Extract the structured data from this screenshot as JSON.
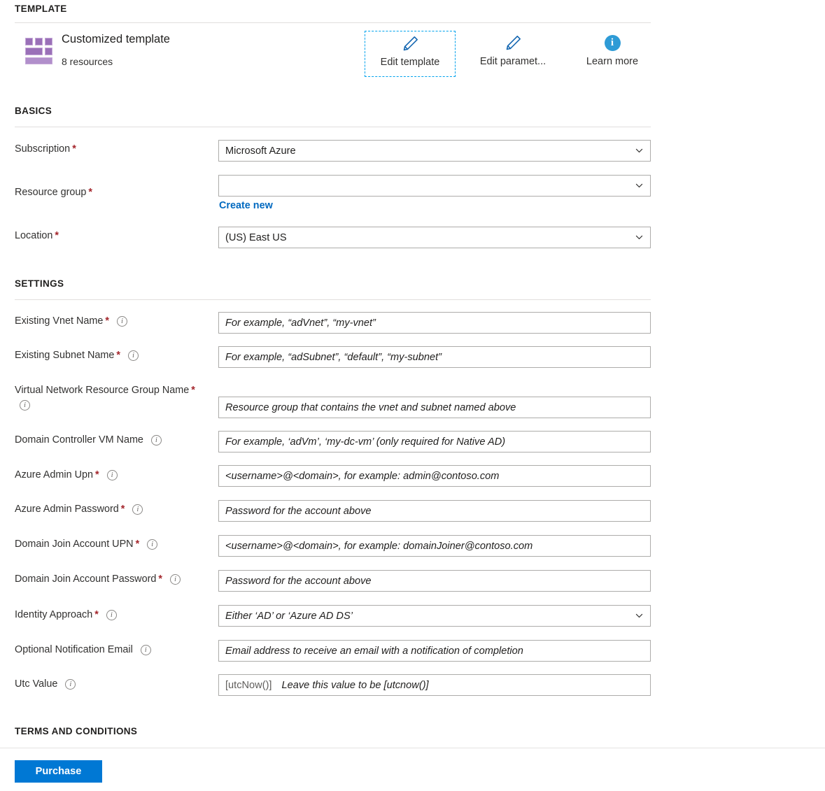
{
  "sections": {
    "template": "TEMPLATE",
    "basics": "BASICS",
    "settings": "SETTINGS",
    "terms": "TERMS AND CONDITIONS"
  },
  "template_card": {
    "icon": "template-grid-icon",
    "title": "Customized template",
    "subtitle": "8 resources",
    "actions": [
      {
        "label": "Edit template",
        "icon": "pencil-icon",
        "focused": true
      },
      {
        "label": "Edit paramet...",
        "icon": "pencil-icon",
        "focused": false
      },
      {
        "label": "Learn more",
        "icon": "info-circle-icon",
        "focused": false
      }
    ]
  },
  "basics": {
    "subscription": {
      "label": "Subscription",
      "required": true,
      "value": "Microsoft Azure",
      "placeholder": "",
      "control": "dropdown"
    },
    "resource_group": {
      "label": "Resource group",
      "required": true,
      "value": "",
      "placeholder": "",
      "control": "dropdown",
      "create_new_link": "Create new"
    },
    "location": {
      "label": "Location",
      "required": true,
      "value": "(US) East US",
      "placeholder": "",
      "control": "dropdown"
    }
  },
  "settings": [
    {
      "label": "Existing Vnet Name",
      "required": true,
      "info": true,
      "placeholder": "For example, “adVnet”, “my-vnet”",
      "control": "text"
    },
    {
      "label": "Existing Subnet Name",
      "required": true,
      "info": true,
      "placeholder": "For example, “adSubnet”, “default”, “my-subnet”",
      "control": "text"
    },
    {
      "label": "Virtual Network Resource Group Name",
      "required": true,
      "info": true,
      "placeholder": "Resource group that contains the vnet and subnet named above",
      "control": "text"
    },
    {
      "label": "Domain Controller VM Name",
      "required": false,
      "info": true,
      "placeholder": "For example, ‘adVm’, ‘my-dc-vm’ (only required for Native AD)",
      "control": "text"
    },
    {
      "label": "Azure Admin Upn",
      "required": true,
      "info": true,
      "placeholder": "<username>@<domain>, for example: admin@contoso.com",
      "control": "text"
    },
    {
      "label": "Azure Admin Password",
      "required": true,
      "info": true,
      "placeholder": "Password for the account above",
      "control": "password"
    },
    {
      "label": "Domain Join Account UPN",
      "required": true,
      "info": true,
      "placeholder": "<username>@<domain>, for example: domainJoiner@contoso.com",
      "control": "text"
    },
    {
      "label": "Domain Join Account Password",
      "required": true,
      "info": true,
      "placeholder": "Password for the account above",
      "control": "password"
    },
    {
      "label": "Identity Approach",
      "required": true,
      "info": true,
      "placeholder": "Either ‘AD’ or ‘Azure AD DS’",
      "control": "dropdown"
    },
    {
      "label": "Optional Notification Email",
      "required": false,
      "info": true,
      "placeholder": "Email address to receive an email with a notification of completion",
      "control": "text"
    },
    {
      "label": "Utc Value",
      "required": false,
      "info": true,
      "value": "[utcNow()]",
      "placeholder": "Leave this value to be [utcnow()]",
      "control": "text"
    }
  ],
  "footer": {
    "purchase_label": "Purchase"
  },
  "colors": {
    "accent": "#0078d4",
    "required_asterisk": "#a4262c",
    "link": "#0069c0",
    "focus_outline": "#00a2ed",
    "template_icon": "#9a70b8"
  }
}
